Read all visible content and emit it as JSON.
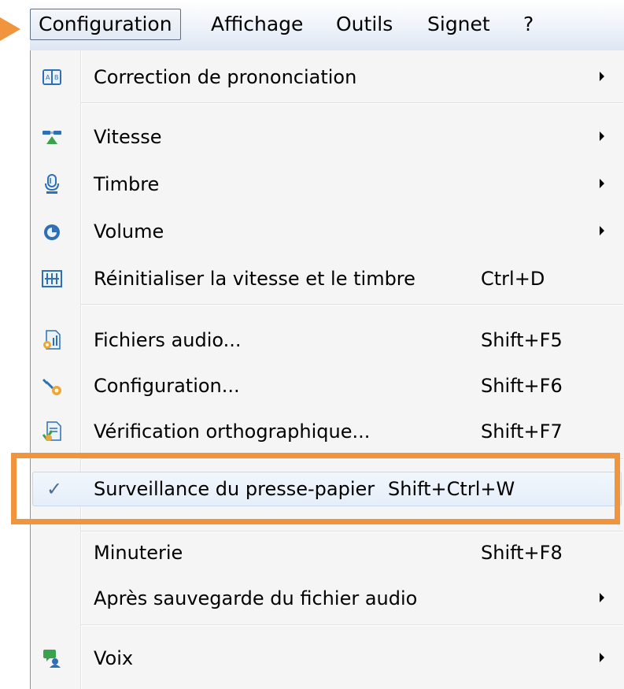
{
  "menubar": {
    "items": [
      {
        "label": "Configuration",
        "active": true
      },
      {
        "label": "Affichage"
      },
      {
        "label": "Outils"
      },
      {
        "label": "Signet"
      },
      {
        "label": "?"
      }
    ]
  },
  "menu": {
    "items": [
      {
        "label": "Correction de prononciation",
        "icon": "dictionary-icon",
        "submenu": true
      },
      {
        "label": "Vitesse",
        "icon": "speed-icon",
        "submenu": true
      },
      {
        "label": "Timbre",
        "icon": "microphone-icon",
        "submenu": true
      },
      {
        "label": "Volume",
        "icon": "volume-icon",
        "submenu": true
      },
      {
        "label": "Réinitialiser la vitesse et le timbre",
        "icon": "equalizer-icon",
        "shortcut": "Ctrl+D"
      },
      {
        "label": "Fichiers audio...",
        "icon": "audio-file-icon",
        "shortcut": "Shift+F5"
      },
      {
        "label": "Configuration...",
        "icon": "tools-icon",
        "shortcut": "Shift+F6"
      },
      {
        "label": "Vérification orthographique...",
        "icon": "spellcheck-icon",
        "shortcut": "Shift+F7"
      },
      {
        "label": "Surveillance du presse-papier",
        "checked": true,
        "shortcut": "Shift+Ctrl+W"
      },
      {
        "label": "Minuterie",
        "shortcut": "Shift+F8"
      },
      {
        "label": "Après sauvegarde du fichier audio",
        "submenu": true
      },
      {
        "label": "Voix",
        "icon": "voice-icon",
        "submenu": true
      }
    ]
  },
  "colors": {
    "highlight": "#f0953d",
    "check": "#4f6d96"
  }
}
